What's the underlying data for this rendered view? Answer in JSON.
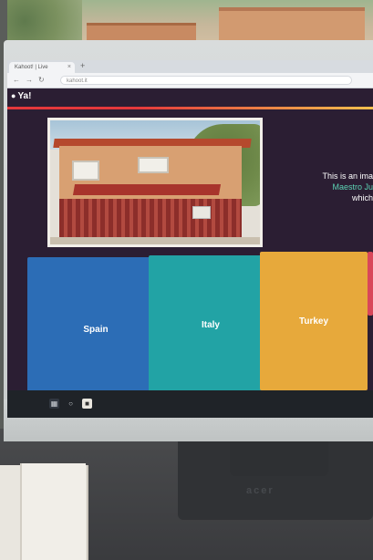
{
  "browser": {
    "tab_title": "Kahoot! | Live",
    "tab_close": "×",
    "new_tab": "+",
    "nav": {
      "back": "←",
      "forward": "→",
      "reload": "↻"
    },
    "url": "kahoot.it"
  },
  "quiz": {
    "logo": "Ya!",
    "prompt_lines": [
      "This is an ima",
      "Maestro Ju",
      "which"
    ],
    "answers": [
      {
        "label": "Spain"
      },
      {
        "label": "Italy"
      },
      {
        "label": "Turkey"
      },
      {
        "label": ""
      }
    ]
  },
  "monitor": {
    "brand": "acer",
    "base_logo": "acer"
  },
  "colors": {
    "answer_blue": "#2c6db6",
    "answer_teal": "#22a3a5",
    "answer_orange": "#e7a93b",
    "answer_red": "#d9475a",
    "accent_text": "#5cd3b4",
    "page_bg": "#2b1e33"
  },
  "icons": {
    "start": "windows-start-icon",
    "search": "search-icon",
    "app": "app-icon"
  }
}
